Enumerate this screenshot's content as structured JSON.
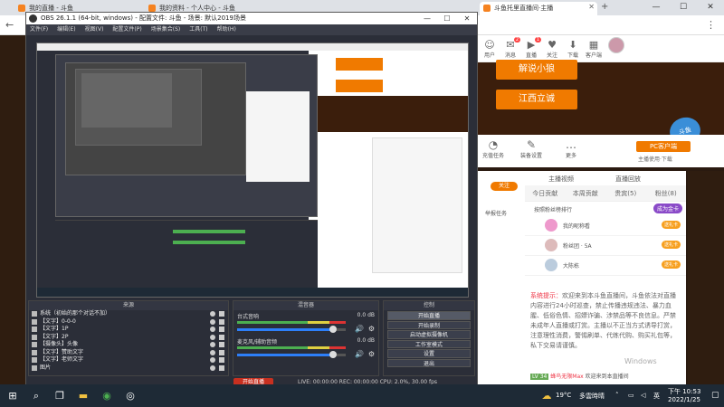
{
  "browser": {
    "tabs": [
      {
        "label": "我的直播 - 斗鱼"
      },
      {
        "label": "我的资料 - 个人中心 - 斗鱼"
      },
      {
        "label": "斗鱼托里直播间·主播"
      }
    ],
    "new_tab": "+",
    "window_controls": {
      "minimize": "—",
      "maximize": "☐",
      "close": "✕"
    },
    "nav": {
      "back": "←"
    }
  },
  "site": {
    "header_icons": [
      {
        "name": "用户",
        "glyph": "☺",
        "badge": ""
      },
      {
        "name": "消息",
        "glyph": "✉",
        "badge": "2"
      },
      {
        "name": "直播",
        "glyph": "▶",
        "badge": "1"
      },
      {
        "name": "关注",
        "glyph": "♥",
        "badge": ""
      },
      {
        "name": "下载",
        "glyph": "⬇",
        "badge": ""
      },
      {
        "name": "客户端",
        "glyph": "▦",
        "badge": ""
      }
    ],
    "stream_buttons": [
      "解说小狼",
      "江西立诚"
    ],
    "tools": [
      {
        "label": "充值任务",
        "glyph": "◔"
      },
      {
        "label": "装备设置",
        "glyph": "✎"
      },
      {
        "label": "更多",
        "glyph": "…"
      }
    ],
    "pc_client_btn": "PC客户端",
    "client_download": "主播使用·下载",
    "follow_btn": "关注",
    "report_btn": "举报任务",
    "chat": {
      "top_tabs": [
        "主播视频",
        "直播回放"
      ],
      "tabs": [
        "今日贡献",
        "本周贡献",
        "贵宾(5)",
        "粉丝(8)"
      ],
      "rank_title": "按照粉丝榜排行",
      "rank_btn": "成为金卡",
      "rows": [
        {
          "name": "我的昵称看",
          "pill": "送礼卡"
        },
        {
          "name": "粉丝团 · 5A",
          "pill": "送礼卡"
        },
        {
          "name": "大陈栋",
          "pill": "送礼卡"
        }
      ],
      "system_label": "系统提示：",
      "system_text": "欢迎来到本斗鱼直播间，斗鱼依法对直播内容进行24小时巡查，禁止传播违规违法、暴力血腥、低俗色情、招嫖诈骗、涉禁品等不良信息。严禁未成年人直播或打赏。主播以不正当方式诱导打赏，注意理性消费，警惕刷单、代练代购、购买礼包等，私下交易请谨慎。",
      "welcome_badge": "LV 34",
      "welcome_user": "蜂鸟无限Max",
      "welcome_text": "欢迎来到本直播间"
    },
    "watermark": "Windows"
  },
  "obs": {
    "title": "OBS 26.1.1 (64-bit, windows) - 配置文件: 斗鱼 - 场景: 默认2019场景",
    "menu": [
      "文件(F)",
      "编辑(E)",
      "视图(V)",
      "配置文件(P)",
      "场景集合(S)",
      "工具(T)",
      "帮助(H)"
    ],
    "docks": {
      "sources_title": "来源",
      "mixer_title": "混音器",
      "controls_title": "控制"
    },
    "sources": [
      "系统（初始的那个对话不加）",
      "【文字】0-0-0",
      "【文字】1P",
      "【文字】2P",
      "【摄像头】头像",
      "【文字】赞助文字",
      "【文字】老师文字",
      "图片"
    ],
    "mixer": [
      {
        "name": "台式音响",
        "db": "0.0 dB",
        "level": 0.88
      },
      {
        "name": "麦克风/辅助音频",
        "db": "0.0 dB",
        "level": 0.88
      }
    ],
    "controls": [
      "开始直播",
      "开始录制",
      "启动虚拟摄像机",
      "工作室模式",
      "设置",
      "退出"
    ],
    "status": "LIVE: 00:00:00   REC: 00:00:00   CPU: 2.0%, 30.00 fps",
    "red_button": "开始直播"
  },
  "taskbar": {
    "temperature": "19°C",
    "weather": "多雲時晴",
    "ime": "英",
    "time": "下午 10:53",
    "date": "2022/1/25"
  }
}
